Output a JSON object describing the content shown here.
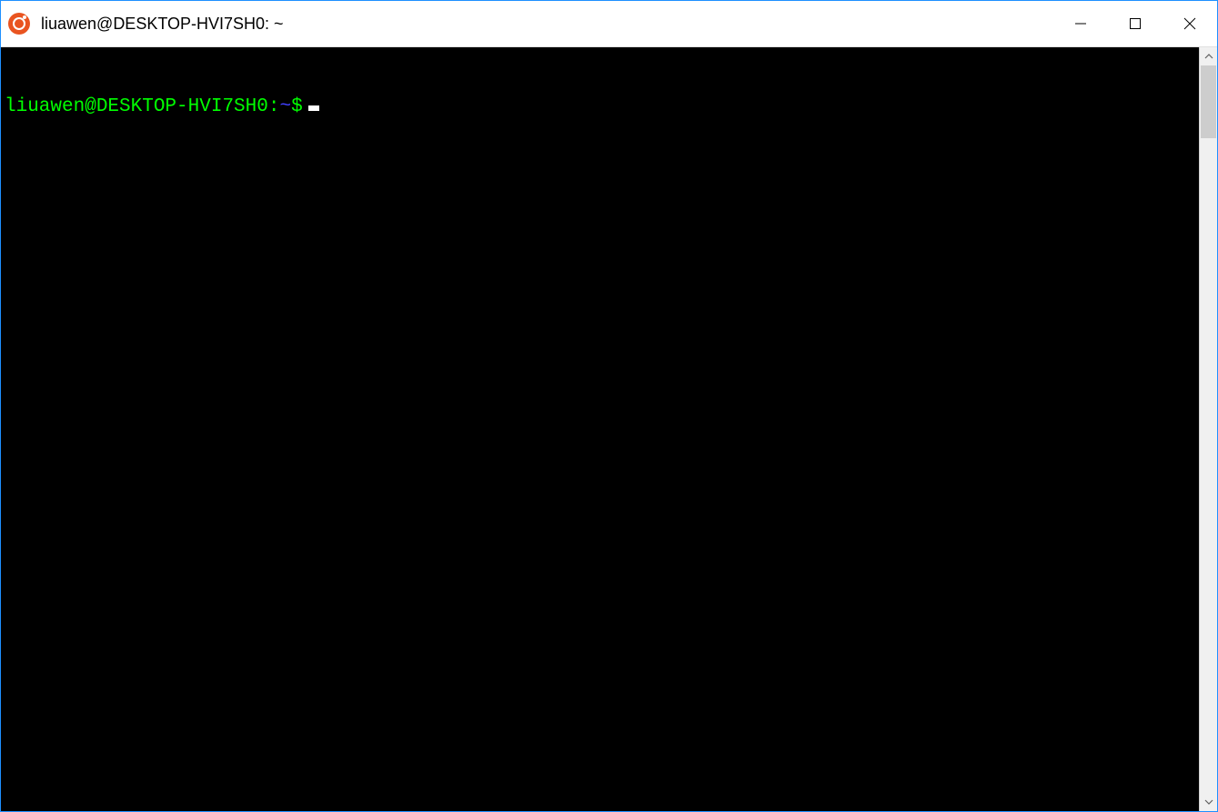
{
  "window": {
    "title": "liuawen@DESKTOP-HVI7SH0: ~"
  },
  "terminal": {
    "prompt_userhost": "liuawen@DESKTOP-HVI7SH0",
    "prompt_colon": ":",
    "prompt_path": "~",
    "prompt_dollar": "$",
    "current_input": ""
  },
  "colors": {
    "terminal_bg": "#000000",
    "prompt_green": "#00ff00",
    "prompt_blue": "#4040ff",
    "window_border": "#1e90ff",
    "ubuntu_orange": "#E95420"
  }
}
